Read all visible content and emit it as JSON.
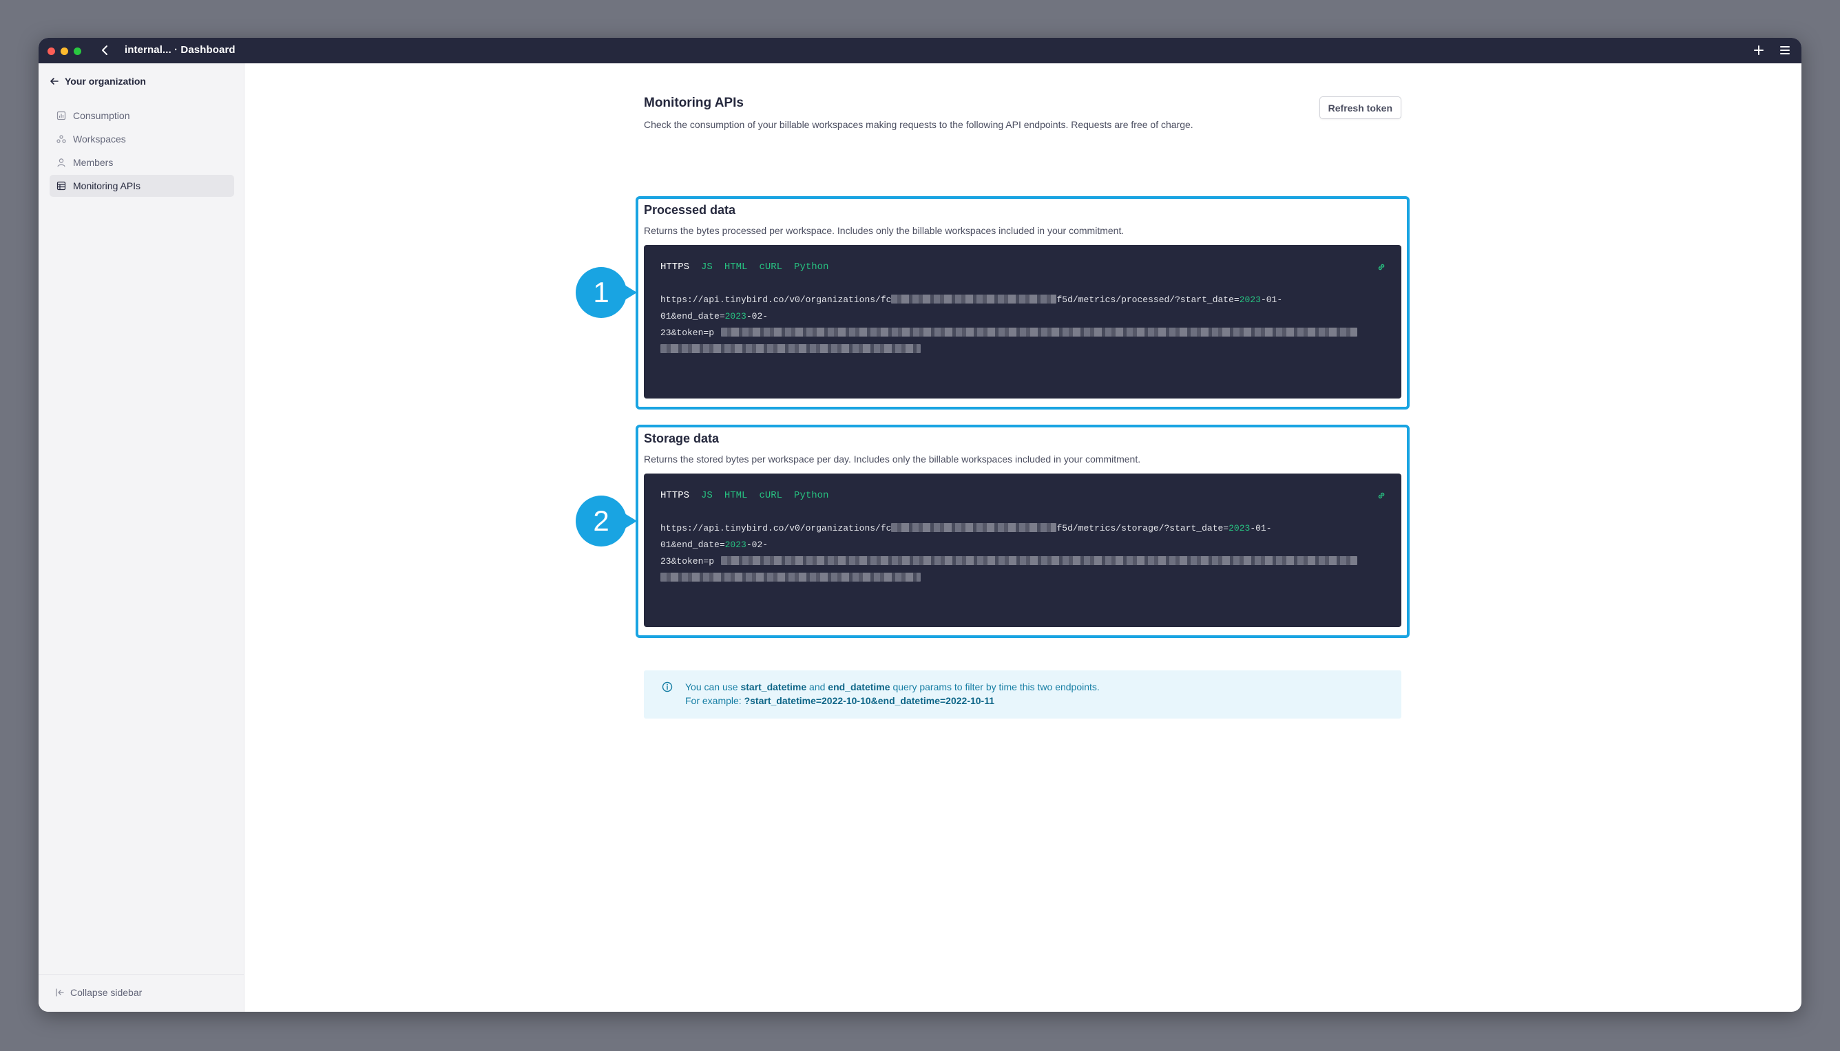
{
  "window": {
    "title": "internal... · Dashboard"
  },
  "sidebar": {
    "back_label": "Your organization",
    "items": [
      {
        "label": "Consumption",
        "icon": "consumption-icon"
      },
      {
        "label": "Workspaces",
        "icon": "workspaces-icon"
      },
      {
        "label": "Members",
        "icon": "members-icon"
      },
      {
        "label": "Monitoring APIs",
        "icon": "monitoring-icon",
        "active": true
      }
    ],
    "collapse_label": "Collapse sidebar"
  },
  "page": {
    "title": "Monitoring APIs",
    "description": "Check the consumption of your billable workspaces making requests to the following API endpoints. Requests are free of charge.",
    "refresh_button": "Refresh token"
  },
  "sections": [
    {
      "callout": "1",
      "title": "Processed data",
      "description": "Returns the bytes processed per workspace. Includes only the billable workspaces included in your commitment.",
      "tabs": [
        "HTTPS",
        "JS",
        "HTML",
        "cURL",
        "Python"
      ],
      "active_tab": "HTTPS",
      "code": {
        "l1_prefix": "https://api.tinybird.co/v0/organizations/fc",
        "l1_suffix": "f5d/metrics/processed/?start_date=",
        "start_year": "2023",
        "start_rest": "-01-",
        "l2_prefix": "01&end_date=",
        "end_year": "2023",
        "end_rest": "-02-",
        "l3_prefix": "23&token=p"
      }
    },
    {
      "callout": "2",
      "title": "Storage data",
      "description": "Returns the stored bytes per workspace per day. Includes only the billable workspaces included in your commitment.",
      "tabs": [
        "HTTPS",
        "JS",
        "HTML",
        "cURL",
        "Python"
      ],
      "active_tab": "HTTPS",
      "code": {
        "l1_prefix": "https://api.tinybird.co/v0/organizations/fc",
        "l1_suffix": "f5d/metrics/storage/?start_date=",
        "start_year": "2023",
        "start_rest": "-01-",
        "l2_prefix": "01&end_date=",
        "end_year": "2023",
        "end_rest": "-02-",
        "l3_prefix": "23&token=p"
      }
    }
  ],
  "info": {
    "t1": "You can use",
    "p1": "start_datetime",
    "t2": "and",
    "p2": "end_datetime",
    "t3": "query params to filter by time this two endpoints.",
    "t4": "For example:",
    "example": "?start_datetime=2022-10-10&end_datetime=2022-10-11"
  },
  "colors": {
    "accent_highlight": "#19a4e2",
    "code_background": "#25283d",
    "code_accent": "#27c281",
    "info_background": "#e8f6fc"
  }
}
